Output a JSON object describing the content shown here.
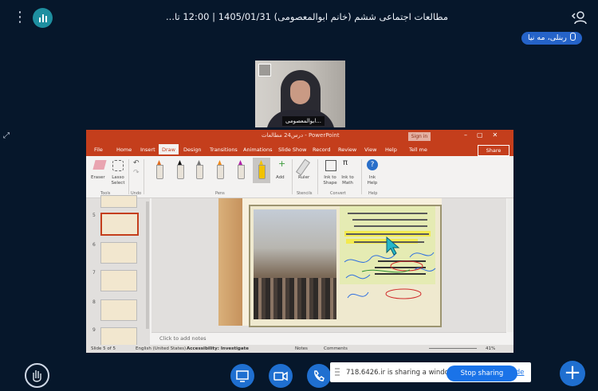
{
  "meeting": {
    "title": "مطالعات اجتماعی ششم (خانم ابوالمعصومی) 1405/01/31 | 12:00 تا...",
    "presenter_name": "ربنلی، مه نیا",
    "webcam_label": "ابوالمعصومی..."
  },
  "ppt": {
    "window_title": "درس24 مطالعات - PowerPoint",
    "sign_in": "Sign in",
    "share": "Share",
    "tabs": [
      "File",
      "Home",
      "Insert",
      "Draw",
      "Design",
      "Transitions",
      "Animations",
      "Slide Show",
      "Record",
      "Review",
      "View",
      "Help",
      "Tell me"
    ],
    "ribbon": {
      "eraser": "Eraser",
      "lasso": "Lasso Select",
      "add": "Add",
      "ruler": "Ruler",
      "ink_to_shape": "Ink to Shape",
      "ink_to_math": "Ink to Math",
      "ink_help": "Ink Help",
      "groups": {
        "tools": "Tools",
        "undo": "Undo",
        "pens": "Pens",
        "stencils": "Stencils",
        "convert": "Convert",
        "help": "Help"
      }
    },
    "slide_numbers": [
      "5",
      "6",
      "7",
      "8",
      "9"
    ],
    "notes_placeholder": "Click to add notes",
    "status": {
      "slide": "Slide 5 of 5",
      "language": "English (United States)",
      "accessibility": "Accessibility: Investigate",
      "notes": "Notes",
      "comments": "Comments",
      "zoom": "41%"
    }
  },
  "sharing": {
    "text": "718.6426.ir is sharing a window.",
    "stop": "Stop sharing",
    "hide": "Hide"
  },
  "colors": {
    "ppt_red": "#c43e1c",
    "bg": "#06172b",
    "accent_blue": "#1f6fd0"
  }
}
